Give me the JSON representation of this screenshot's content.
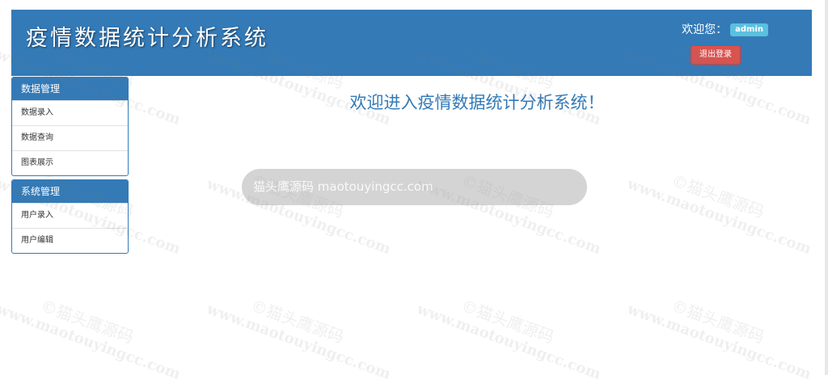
{
  "header": {
    "title": "疫情数据统计分析系统",
    "welcome_label": "欢迎您：",
    "username": "admin",
    "logout_label": "退出登录"
  },
  "sidebar": {
    "panels": [
      {
        "heading": "数据管理",
        "items": [
          "数据录入",
          "数据查询",
          "图表展示"
        ]
      },
      {
        "heading": "系统管理",
        "items": [
          "用户录入",
          "用户编辑"
        ]
      }
    ]
  },
  "main": {
    "welcome_text": "欢迎进入疫情数据统计分析系统！"
  },
  "watermark": {
    "cn": "©猫头鹰源码",
    "url": "www.maotouyingcc.com"
  },
  "toast": {
    "text": "猫头鹰源码 maotouyingcc.com"
  },
  "colors": {
    "primary": "#337ab7",
    "danger": "#d9534f",
    "info": "#5bc0de"
  }
}
